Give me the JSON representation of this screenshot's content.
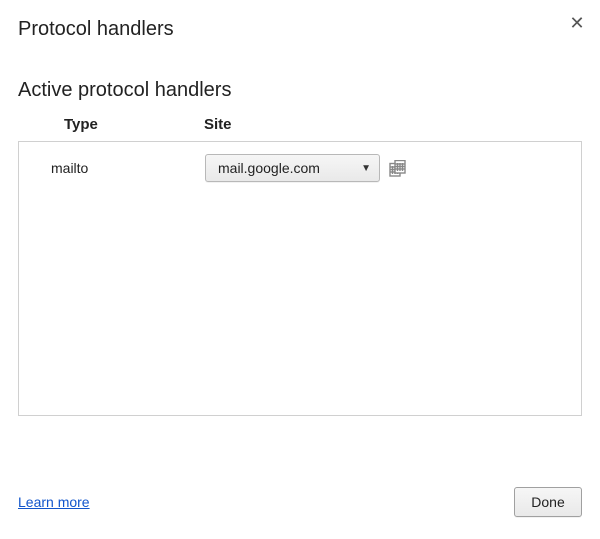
{
  "close_symbol": "✕",
  "title": "Protocol handlers",
  "section_title": "Active protocol handlers",
  "columns": {
    "type": "Type",
    "site": "Site"
  },
  "handlers": [
    {
      "type": "mailto",
      "site": "mail.google.com"
    }
  ],
  "footer": {
    "learn_more": "Learn more",
    "done": "Done"
  }
}
